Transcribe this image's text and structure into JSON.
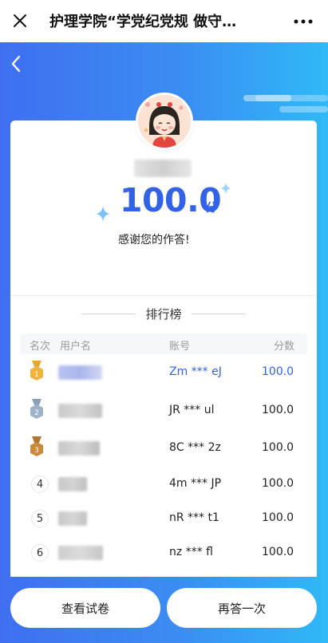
{
  "titlebar": {
    "title": "护理学院“学党纪党规 做守…"
  },
  "result": {
    "score": "100.0",
    "unit": "分",
    "message": "感谢您的作答!"
  },
  "ranking": {
    "title": "排行榜",
    "headers": {
      "rank": "名次",
      "username": "用户名",
      "account": "账号",
      "score": "分数"
    },
    "rows": [
      {
        "rank": "1",
        "account": "Zm *** eJ",
        "score": "100.0"
      },
      {
        "rank": "2",
        "account": "JR *** ul",
        "score": "100.0"
      },
      {
        "rank": "3",
        "account": "8C *** 2z",
        "score": "100.0"
      },
      {
        "rank": "4",
        "account": "4m *** JP",
        "score": "100.0"
      },
      {
        "rank": "5",
        "account": "nR *** t1",
        "score": "100.0"
      },
      {
        "rank": "6",
        "account": "nz *** fl",
        "score": "100.0"
      }
    ]
  },
  "buttons": {
    "view_paper": "查看试卷",
    "retry": "再答一次"
  },
  "colors": {
    "accent": "#3262e6",
    "gold": "#f2b33d",
    "silver": "#9fb3c8",
    "bronze": "#c98a3c"
  }
}
